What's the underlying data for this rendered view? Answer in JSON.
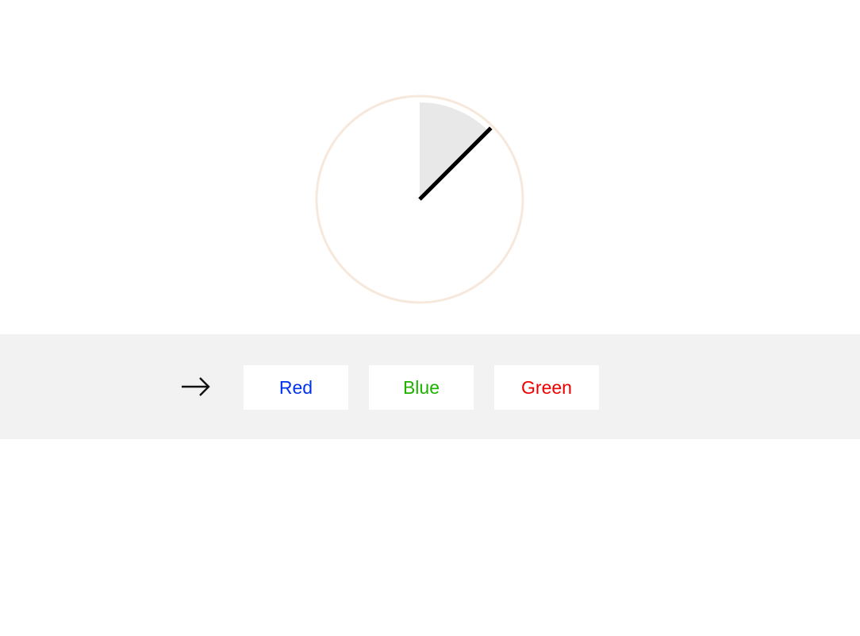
{
  "timer": {
    "elapsed_fraction": 0.125,
    "ring_color": "#f7e8dc",
    "wedge_color": "#e8e8e8",
    "hand_color": "#000000"
  },
  "prompt": {
    "icon": "arrow-right-icon"
  },
  "choices": [
    {
      "label": "Red",
      "color": "#0033ee"
    },
    {
      "label": "Blue",
      "color": "#1db100"
    },
    {
      "label": "Green",
      "color": "#ee0000"
    }
  ],
  "colors": {
    "answer_bar_background": "#f2f2f2",
    "page_background": "#ffffff"
  }
}
